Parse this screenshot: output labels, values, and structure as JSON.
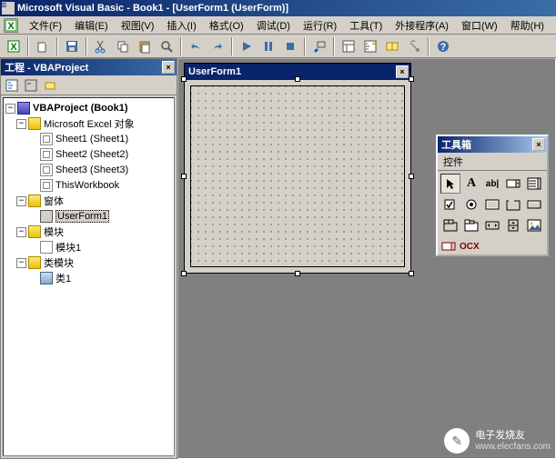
{
  "titlebar": {
    "text": "Microsoft Visual Basic - Book1 - [UserForm1 (UserForm)]"
  },
  "menus": {
    "file": "文件(F)",
    "edit": "编辑(E)",
    "view": "视图(V)",
    "insert": "插入(I)",
    "format": "格式(O)",
    "debug": "调试(D)",
    "run": "运行(R)",
    "tools": "工具(T)",
    "addins": "外接程序(A)",
    "window": "窗口(W)",
    "help": "帮助(H)"
  },
  "project_panel": {
    "title": "工程 - VBAProject"
  },
  "tree": {
    "root": "VBAProject (Book1)",
    "excel_objects": "Microsoft Excel 对象",
    "sheet1": "Sheet1 (Sheet1)",
    "sheet2": "Sheet2 (Sheet2)",
    "sheet3": "Sheet3 (Sheet3)",
    "thisworkbook": "ThisWorkbook",
    "forms": "窗体",
    "userform1": "UserForm1",
    "modules": "模块",
    "module1": "模块1",
    "class_modules": "类模块",
    "class1": "类1"
  },
  "form_designer": {
    "title": "UserForm1"
  },
  "toolbox": {
    "title": "工具箱",
    "tab": "控件",
    "ocx": "OCX"
  },
  "watermark": {
    "name": "电子发烧友",
    "url": "www.elecfans.com"
  }
}
